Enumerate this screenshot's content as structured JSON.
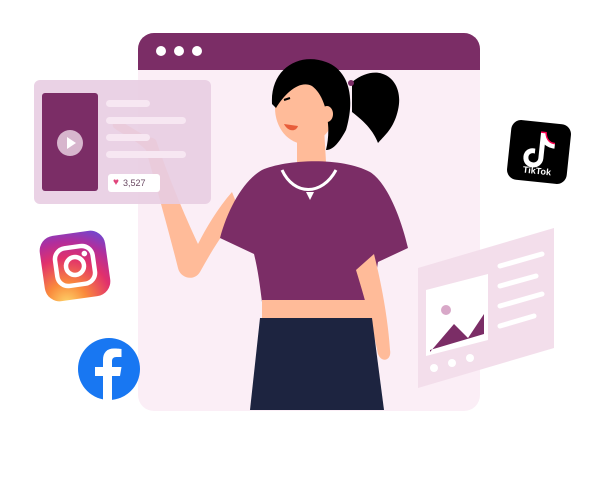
{
  "video_card": {
    "likes_count": "3,527",
    "heart_icon": "heart-icon",
    "play_icon": "play-icon"
  },
  "social": {
    "tiktok_label": "TikTok",
    "instagram_icon": "instagram-icon",
    "facebook_icon": "facebook-icon"
  },
  "colors": {
    "brand_purple": "#7b2d66",
    "window_bg": "#fbeef6",
    "card_pink": "#e8cde2",
    "facebook_blue": "#1877f2"
  }
}
